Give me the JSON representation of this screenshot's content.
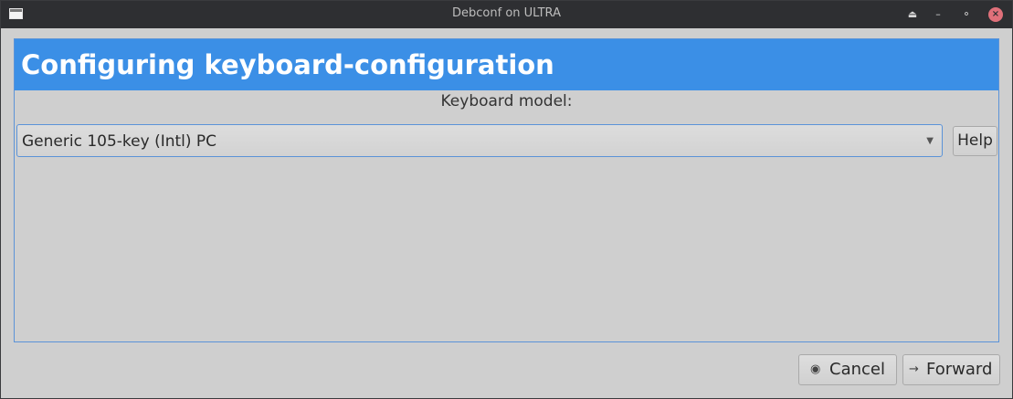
{
  "window": {
    "title": "Debconf on ULTRA",
    "icons": {
      "app": "window-app-icon",
      "keep_above": "eject-up-icon",
      "minimize": "minimize-icon",
      "restore": "restore-icon",
      "close": "close-icon"
    },
    "close_color": "#e0707a"
  },
  "banner": {
    "heading": "Configuring keyboard-configuration",
    "color": "#3b8fe6"
  },
  "question": {
    "label": "Keyboard model:"
  },
  "keyboard_model_select": {
    "selected": "Generic 105-key (Intl) PC"
  },
  "buttons": {
    "help": "Help",
    "cancel": "Cancel",
    "forward": "Forward"
  }
}
